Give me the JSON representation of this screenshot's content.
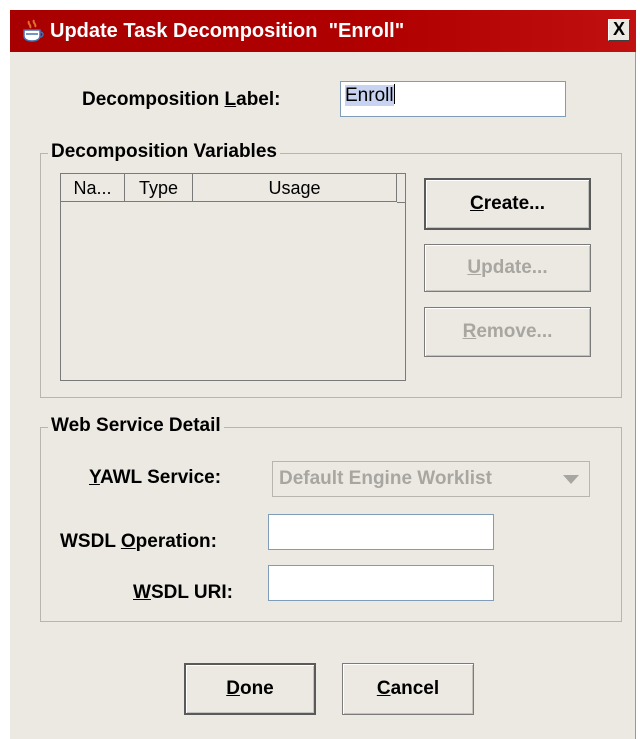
{
  "window": {
    "title": "Update Task Decomposition  \"Enroll\"",
    "close_label": "X"
  },
  "decomposition": {
    "label_prefix": "Decomposition ",
    "label_mnemonic": "L",
    "label_suffix": "abel:",
    "value": "Enroll"
  },
  "variables_group": {
    "title": "Decomposition Variables",
    "columns": [
      "Na...",
      "Type",
      "Usage"
    ],
    "rows": [],
    "buttons": {
      "create": {
        "mnemonic": "C",
        "rest": "reate..."
      },
      "update": {
        "mnemonic": "U",
        "rest": "pdate..."
      },
      "remove": {
        "mnemonic": "R",
        "rest": "emove..."
      }
    }
  },
  "web_service_group": {
    "title": "Web Service Detail",
    "yawl_service": {
      "mnemonic": "Y",
      "rest": "AWL Service:",
      "selected": "Default Engine Worklist"
    },
    "wsdl_operation": {
      "prefix": "WSDL ",
      "mnemonic": "O",
      "rest": "peration:",
      "value": ""
    },
    "wsdl_uri": {
      "mnemonic": "W",
      "rest": "SDL URI:",
      "value": ""
    }
  },
  "footer": {
    "done": {
      "mnemonic": "D",
      "rest": "one"
    },
    "cancel": {
      "mnemonic": "C",
      "rest": "ancel"
    }
  },
  "colors": {
    "titlebar": "#b00000",
    "dialog_bg": "#ece9e2",
    "disabled_text": "#a8a6a0",
    "field_border": "#7f9db9"
  },
  "icons": {
    "title": "java-coffee-cup-icon",
    "combo_arrow": "chevron-down-icon"
  }
}
